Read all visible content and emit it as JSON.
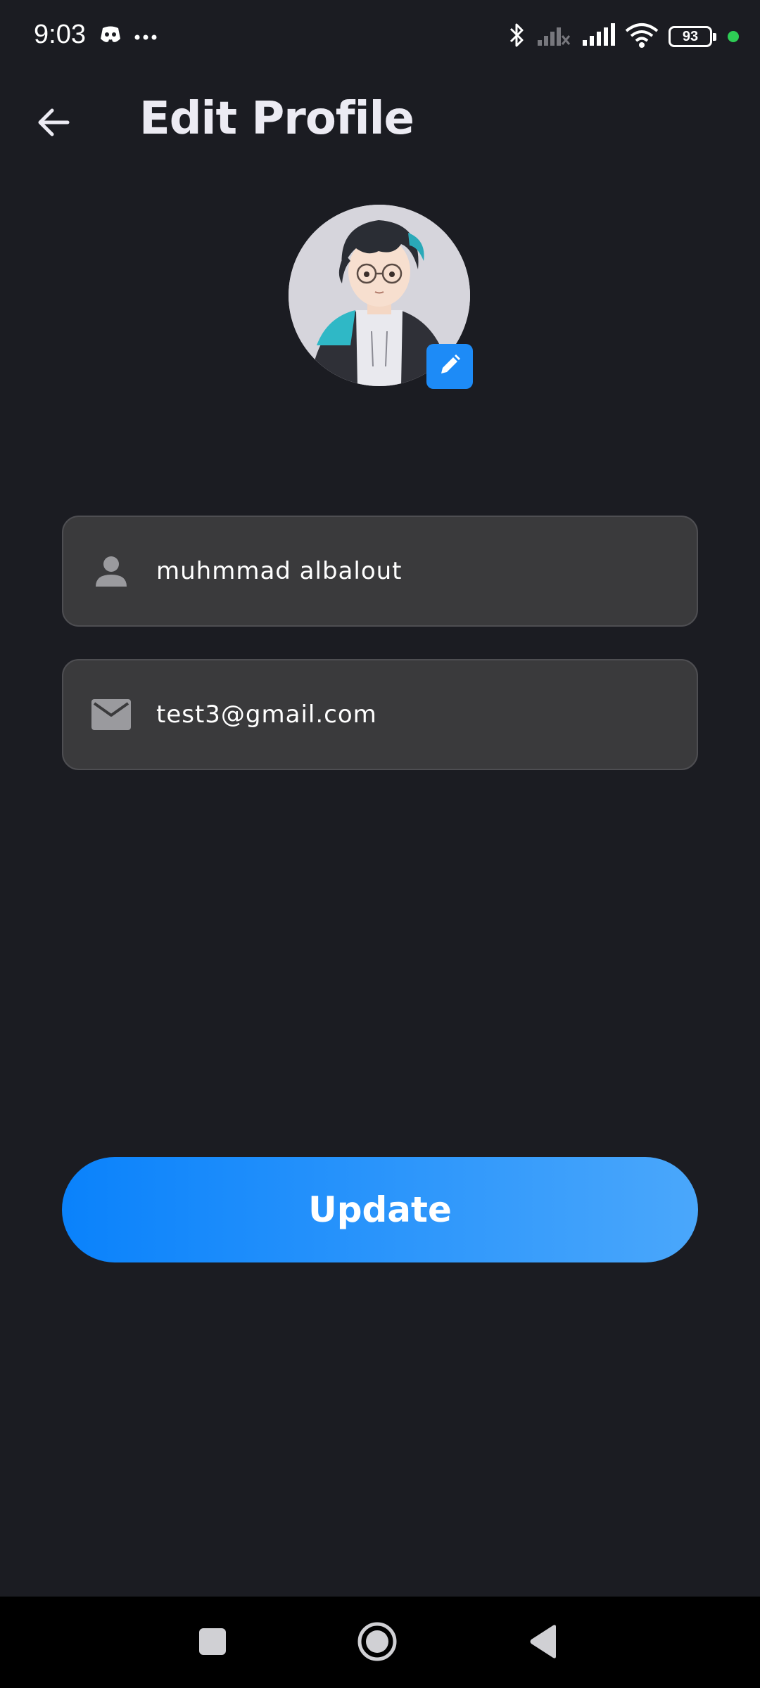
{
  "status_bar": {
    "time": "9:03",
    "battery_level": "93",
    "icons": [
      "discord-icon",
      "more-dots-icon",
      "bluetooth-icon",
      "signal-off-icon",
      "signal-icon",
      "wifi-icon",
      "battery-icon",
      "privacy-dot-icon"
    ]
  },
  "app_bar": {
    "title": "Edit Profile",
    "back_icon": "arrow-back-icon"
  },
  "avatar": {
    "edit_icon": "pencil-icon"
  },
  "form": {
    "name_value": "muhmmad albalout",
    "name_icon": "person-icon",
    "email_value": "test3@gmail.com",
    "email_icon": "mail-icon"
  },
  "actions": {
    "update_label": "Update"
  },
  "colors": {
    "background": "#1b1c22",
    "field_background": "#3a3a3c",
    "accent_start": "#0a82fb",
    "accent_end": "#4aa7fb",
    "privacy_dot": "#2ecc55"
  },
  "nav_bar": {
    "icons": [
      "recents-square-icon",
      "home-circle-icon",
      "back-triangle-icon"
    ]
  }
}
